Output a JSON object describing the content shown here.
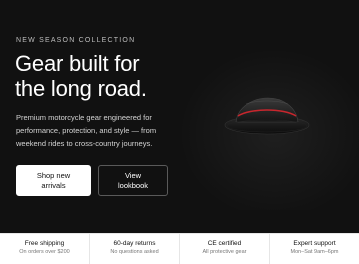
{
  "hero": {
    "eyebrow": "NEW SEASON COLLECTION",
    "headline_line1": "Gear built for",
    "headline_line2": "the long road.",
    "subcopy": "Premium motorcycle gear engineered for performance, protection, and style — from weekend rides to cross-country journeys.",
    "primary_button_line1": "Shop new",
    "primary_button_line2": "arrivals",
    "secondary_button_line1": "View",
    "secondary_button_line2": "lookbook",
    "image_icon": "helmet-image",
    "accent_color": "#c8262d",
    "background_color": "#111111"
  },
  "features": [
    {
      "title": "Free shipping",
      "subtitle": "On orders over $200"
    },
    {
      "title": "60-day returns",
      "subtitle": "No questions asked"
    },
    {
      "title": "CE certified",
      "subtitle": "All protective gear"
    },
    {
      "title": "Expert support",
      "subtitle": "Mon–Sat 9am–6pm"
    }
  ]
}
